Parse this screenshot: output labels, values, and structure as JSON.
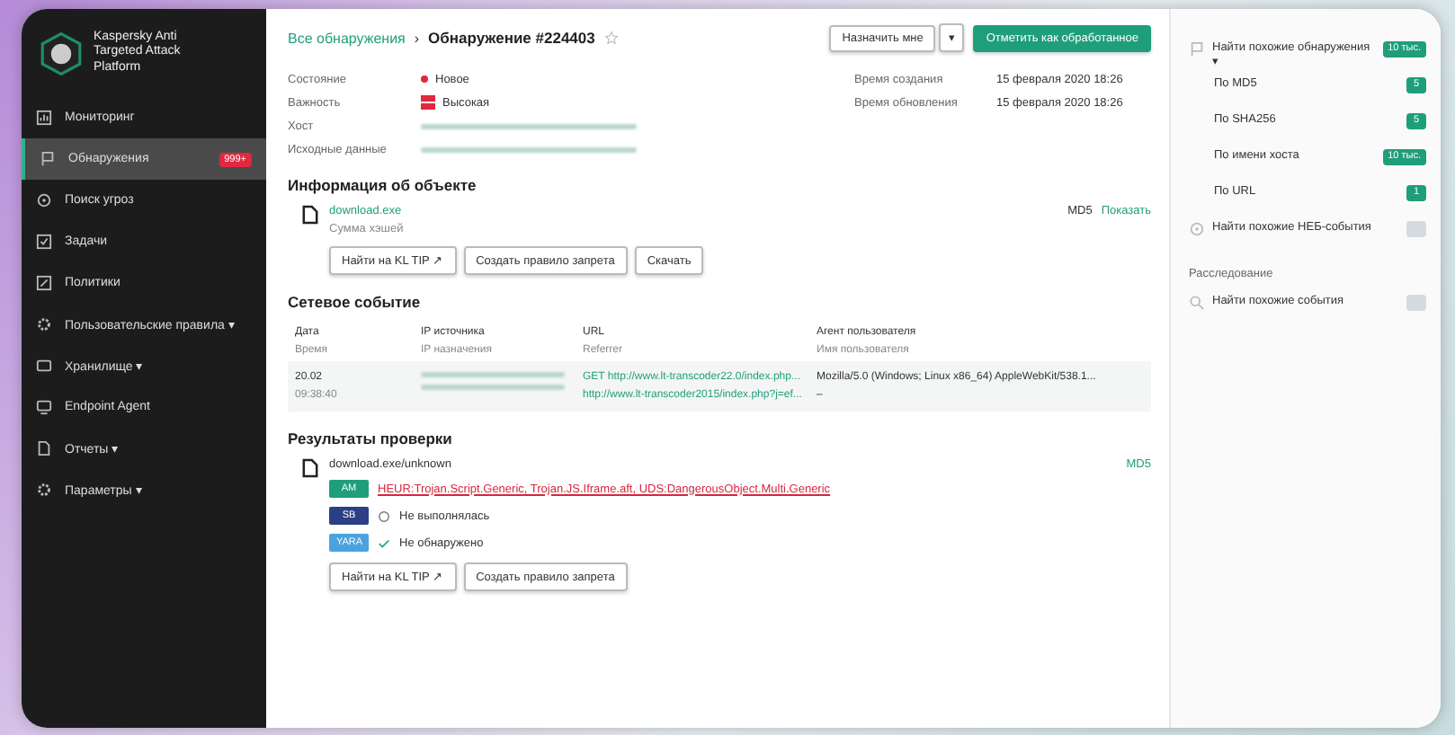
{
  "sidebar": {
    "logo_text": "Kaspersky Anti Targeted Attack Platform",
    "items": [
      {
        "label": "Мониторинг",
        "selected": false
      },
      {
        "label": "Обнаружения",
        "selected": true,
        "badge": "999+"
      },
      {
        "label": "Поиск угроз",
        "selected": false
      },
      {
        "label": "Задачи",
        "selected": false
      },
      {
        "label": "Политики",
        "selected": false
      },
      {
        "label": "Пользовательские правила ▾",
        "selected": false
      },
      {
        "label": "Хранилище ▾",
        "selected": false
      },
      {
        "label": "Endpoint Agent",
        "selected": false
      },
      {
        "label": "Отчеты ▾",
        "selected": false
      },
      {
        "label": "Параметры ▾",
        "selected": false
      }
    ]
  },
  "header": {
    "breadcrumb": "Все обнаружения",
    "separator": "›",
    "title": "Обнаружение #224403",
    "starred": false,
    "assign_button": "Назначить мне",
    "assign_caret": "▾",
    "primary_button": "Отметить как обработанное"
  },
  "details": {
    "left": [
      {
        "label": "Состояние",
        "value": "Новое",
        "kind": "status"
      },
      {
        "label": "Важность",
        "value": "Высокая",
        "kind": "severity"
      },
      {
        "label": "Хост",
        "kind": "hidden"
      },
      {
        "label": "Исходные данные",
        "kind": "hidden"
      }
    ],
    "right": [
      {
        "label": "Время создания",
        "value": "15 февраля 2020 18:26"
      },
      {
        "label": "Время обновления",
        "value": "15 февраля 2020 18:26"
      }
    ]
  },
  "object_info": {
    "title": "Информация об объекте",
    "file_name": "download.exe",
    "file_sub": "Сумма хэшей",
    "hash_label": "MD5",
    "hash_link": "Показать",
    "buttons": [
      "Найти на KL TIP ↗",
      "Создать правило запрета",
      "Скачать"
    ]
  },
  "network_event": {
    "title": "Сетевое событие",
    "columns": [
      {
        "top": "Дата",
        "bottom": "Время"
      },
      {
        "top": "IP источника",
        "bottom": "IP назначения"
      },
      {
        "top": "URL",
        "bottom": "Referrer"
      },
      {
        "top": "Агент пользователя",
        "bottom": "Имя пользователя"
      }
    ],
    "row": {
      "date": "20.02",
      "time": "09:38:40",
      "url": "GET http://www.lt-transcoder22.0/index.php...",
      "referrer": "http://www.lt-transcoder2015/index.php?j=ef...",
      "agent": "Mozilla/5.0 (Windows; Linux x86_64) AppleWebKit/538.1...",
      "user": "–"
    }
  },
  "scan_results": {
    "title": "Результаты проверки",
    "file_name": "download.exe/unknown",
    "hash_label": "MD5",
    "results": [
      {
        "tag": "AM",
        "color": "#1f9e7a",
        "text": "HEUR:Trojan.Script.Generic, Trojan.JS.Iframe.aft, UDS:DangerousObject.Multi.Generic",
        "kind": "threat"
      },
      {
        "tag": "SB",
        "color": "#2c3f86",
        "text": "Не выполнялась",
        "kind": "skipped"
      },
      {
        "tag": "YARA",
        "color": "#4aa3df",
        "text": "Не обнаружено",
        "kind": "clean"
      }
    ],
    "buttons": [
      "Найти на KL TIP ↗",
      "Создать правило запрета"
    ]
  },
  "right_panel": {
    "items": [
      {
        "label": "Найти похожие обнаружения ▾",
        "badge": "10 тыс.",
        "active": true,
        "children": [
          {
            "label": "По MD5",
            "badge": "5",
            "active": true
          },
          {
            "label": "По SHA256",
            "badge": "5",
            "active": true
          },
          {
            "label": "По имени хоста",
            "badge": "10 тыс.",
            "active": true
          },
          {
            "label": "По URL",
            "badge": "1",
            "active": true
          }
        ]
      },
      {
        "label": "Найти похожие НЕБ-события",
        "active": false
      }
    ],
    "section": "Расследование",
    "section_items": [
      {
        "label": "Найти похожие события",
        "active": false
      }
    ]
  }
}
